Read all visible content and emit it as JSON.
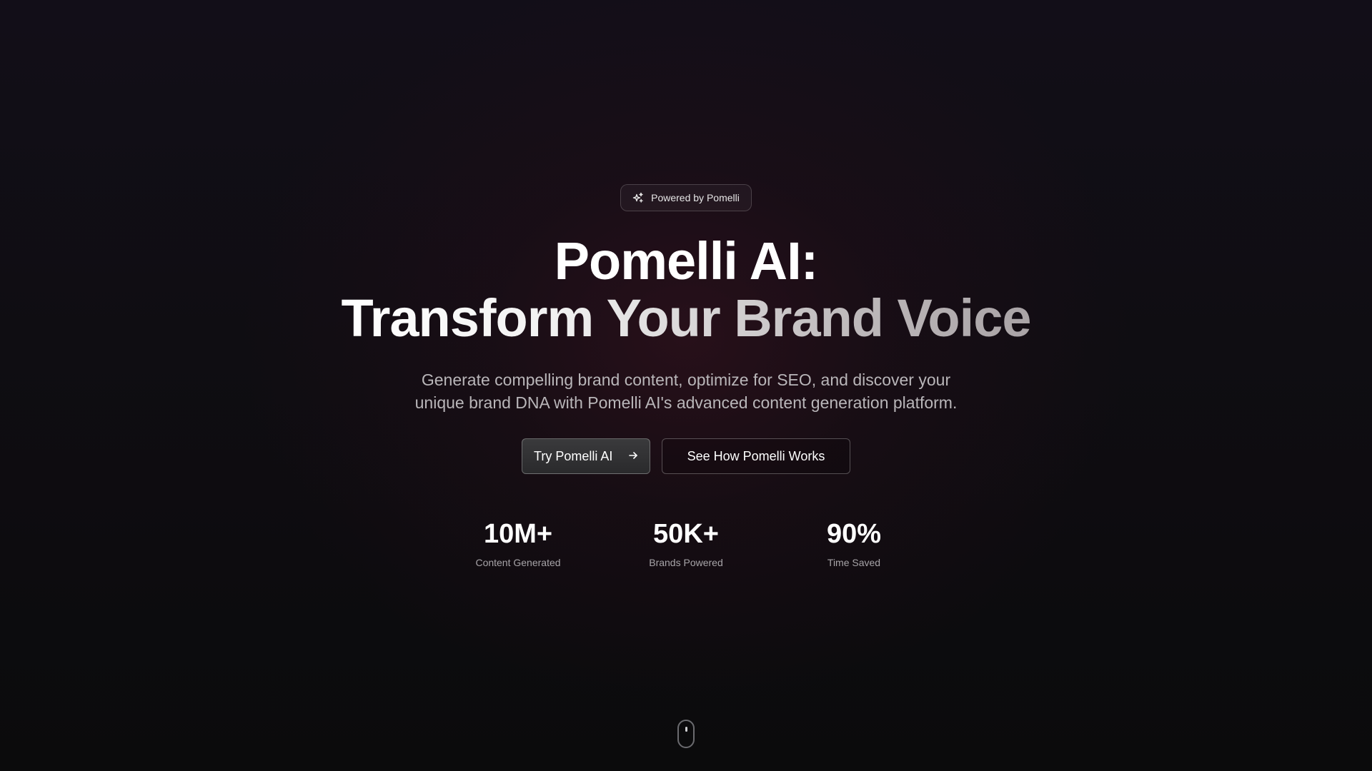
{
  "badge": {
    "icon": "sparkles-icon",
    "label": "Powered by Pomelli"
  },
  "hero": {
    "title_line1": "Pomelli AI:",
    "title_line2": "Transform Your Brand Voice",
    "subtitle": "Generate compelling brand content, optimize for SEO, and discover your unique brand DNA with Pomelli AI's advanced content generation platform."
  },
  "actions": {
    "primary_label": "Try Pomelli AI",
    "primary_icon": "arrow-right-icon",
    "secondary_label": "See How Pomelli Works"
  },
  "stats": [
    {
      "value": "10M+",
      "label": "Content Generated"
    },
    {
      "value": "50K+",
      "label": "Brands Powered"
    },
    {
      "value": "90%",
      "label": "Time Saved"
    }
  ],
  "scroll_indicator": {
    "icon": "mouse-scroll-icon"
  },
  "colors": {
    "background_top": "#120e18",
    "background_bottom": "#0b0b0c",
    "glow": "#3c1220",
    "text_primary": "#ffffff",
    "text_muted": "#b9b6b9"
  }
}
